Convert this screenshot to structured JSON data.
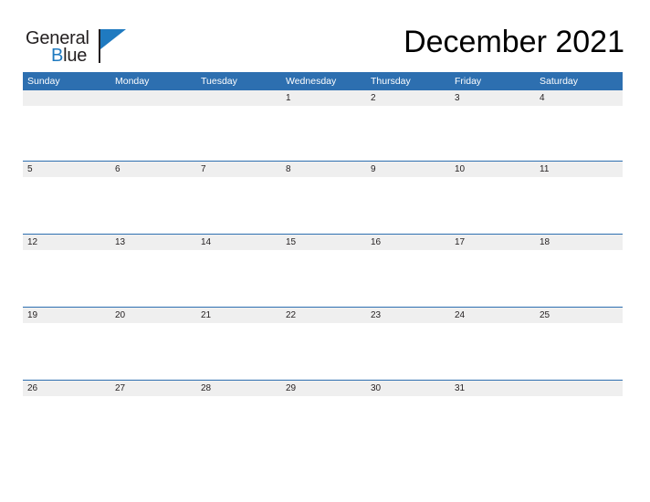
{
  "branding": {
    "logo_word_1": "General",
    "logo_word_2": "Blue",
    "logo_blue_letter": "B",
    "logo_rest": "lue",
    "accent_color": "#1f7ac0"
  },
  "header": {
    "title": "December 2021"
  },
  "calendar": {
    "month": "December",
    "year": "2021",
    "header_bg_color": "#2d6fb0",
    "daynum_bg_color": "#efefef",
    "rule_color": "#2d6fb0",
    "weekday_headers": [
      "Sunday",
      "Monday",
      "Tuesday",
      "Wednesday",
      "Thursday",
      "Friday",
      "Saturday"
    ],
    "weeks": [
      [
        "",
        "",
        "",
        "1",
        "2",
        "3",
        "4"
      ],
      [
        "5",
        "6",
        "7",
        "8",
        "9",
        "10",
        "11"
      ],
      [
        "12",
        "13",
        "14",
        "15",
        "16",
        "17",
        "18"
      ],
      [
        "19",
        "20",
        "21",
        "22",
        "23",
        "24",
        "25"
      ],
      [
        "26",
        "27",
        "28",
        "29",
        "30",
        "31",
        ""
      ]
    ]
  }
}
